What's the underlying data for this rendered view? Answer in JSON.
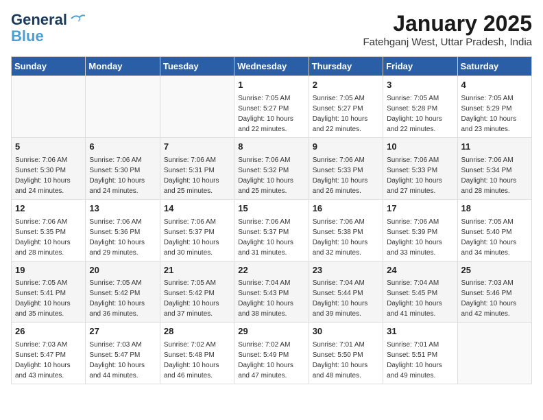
{
  "header": {
    "logo": {
      "line1": "General",
      "line2": "Blue"
    },
    "month": "January 2025",
    "location": "Fatehganj West, Uttar Pradesh, India"
  },
  "weekdays": [
    "Sunday",
    "Monday",
    "Tuesday",
    "Wednesday",
    "Thursday",
    "Friday",
    "Saturday"
  ],
  "weeks": [
    [
      {
        "day": "",
        "sunrise": "",
        "sunset": "",
        "daylight": ""
      },
      {
        "day": "",
        "sunrise": "",
        "sunset": "",
        "daylight": ""
      },
      {
        "day": "",
        "sunrise": "",
        "sunset": "",
        "daylight": ""
      },
      {
        "day": "1",
        "sunrise": "Sunrise: 7:05 AM",
        "sunset": "Sunset: 5:27 PM",
        "daylight": "Daylight: 10 hours and 22 minutes."
      },
      {
        "day": "2",
        "sunrise": "Sunrise: 7:05 AM",
        "sunset": "Sunset: 5:27 PM",
        "daylight": "Daylight: 10 hours and 22 minutes."
      },
      {
        "day": "3",
        "sunrise": "Sunrise: 7:05 AM",
        "sunset": "Sunset: 5:28 PM",
        "daylight": "Daylight: 10 hours and 22 minutes."
      },
      {
        "day": "4",
        "sunrise": "Sunrise: 7:05 AM",
        "sunset": "Sunset: 5:29 PM",
        "daylight": "Daylight: 10 hours and 23 minutes."
      }
    ],
    [
      {
        "day": "5",
        "sunrise": "Sunrise: 7:06 AM",
        "sunset": "Sunset: 5:30 PM",
        "daylight": "Daylight: 10 hours and 24 minutes."
      },
      {
        "day": "6",
        "sunrise": "Sunrise: 7:06 AM",
        "sunset": "Sunset: 5:30 PM",
        "daylight": "Daylight: 10 hours and 24 minutes."
      },
      {
        "day": "7",
        "sunrise": "Sunrise: 7:06 AM",
        "sunset": "Sunset: 5:31 PM",
        "daylight": "Daylight: 10 hours and 25 minutes."
      },
      {
        "day": "8",
        "sunrise": "Sunrise: 7:06 AM",
        "sunset": "Sunset: 5:32 PM",
        "daylight": "Daylight: 10 hours and 25 minutes."
      },
      {
        "day": "9",
        "sunrise": "Sunrise: 7:06 AM",
        "sunset": "Sunset: 5:33 PM",
        "daylight": "Daylight: 10 hours and 26 minutes."
      },
      {
        "day": "10",
        "sunrise": "Sunrise: 7:06 AM",
        "sunset": "Sunset: 5:33 PM",
        "daylight": "Daylight: 10 hours and 27 minutes."
      },
      {
        "day": "11",
        "sunrise": "Sunrise: 7:06 AM",
        "sunset": "Sunset: 5:34 PM",
        "daylight": "Daylight: 10 hours and 28 minutes."
      }
    ],
    [
      {
        "day": "12",
        "sunrise": "Sunrise: 7:06 AM",
        "sunset": "Sunset: 5:35 PM",
        "daylight": "Daylight: 10 hours and 28 minutes."
      },
      {
        "day": "13",
        "sunrise": "Sunrise: 7:06 AM",
        "sunset": "Sunset: 5:36 PM",
        "daylight": "Daylight: 10 hours and 29 minutes."
      },
      {
        "day": "14",
        "sunrise": "Sunrise: 7:06 AM",
        "sunset": "Sunset: 5:37 PM",
        "daylight": "Daylight: 10 hours and 30 minutes."
      },
      {
        "day": "15",
        "sunrise": "Sunrise: 7:06 AM",
        "sunset": "Sunset: 5:37 PM",
        "daylight": "Daylight: 10 hours and 31 minutes."
      },
      {
        "day": "16",
        "sunrise": "Sunrise: 7:06 AM",
        "sunset": "Sunset: 5:38 PM",
        "daylight": "Daylight: 10 hours and 32 minutes."
      },
      {
        "day": "17",
        "sunrise": "Sunrise: 7:06 AM",
        "sunset": "Sunset: 5:39 PM",
        "daylight": "Daylight: 10 hours and 33 minutes."
      },
      {
        "day": "18",
        "sunrise": "Sunrise: 7:05 AM",
        "sunset": "Sunset: 5:40 PM",
        "daylight": "Daylight: 10 hours and 34 minutes."
      }
    ],
    [
      {
        "day": "19",
        "sunrise": "Sunrise: 7:05 AM",
        "sunset": "Sunset: 5:41 PM",
        "daylight": "Daylight: 10 hours and 35 minutes."
      },
      {
        "day": "20",
        "sunrise": "Sunrise: 7:05 AM",
        "sunset": "Sunset: 5:42 PM",
        "daylight": "Daylight: 10 hours and 36 minutes."
      },
      {
        "day": "21",
        "sunrise": "Sunrise: 7:05 AM",
        "sunset": "Sunset: 5:42 PM",
        "daylight": "Daylight: 10 hours and 37 minutes."
      },
      {
        "day": "22",
        "sunrise": "Sunrise: 7:04 AM",
        "sunset": "Sunset: 5:43 PM",
        "daylight": "Daylight: 10 hours and 38 minutes."
      },
      {
        "day": "23",
        "sunrise": "Sunrise: 7:04 AM",
        "sunset": "Sunset: 5:44 PM",
        "daylight": "Daylight: 10 hours and 39 minutes."
      },
      {
        "day": "24",
        "sunrise": "Sunrise: 7:04 AM",
        "sunset": "Sunset: 5:45 PM",
        "daylight": "Daylight: 10 hours and 41 minutes."
      },
      {
        "day": "25",
        "sunrise": "Sunrise: 7:03 AM",
        "sunset": "Sunset: 5:46 PM",
        "daylight": "Daylight: 10 hours and 42 minutes."
      }
    ],
    [
      {
        "day": "26",
        "sunrise": "Sunrise: 7:03 AM",
        "sunset": "Sunset: 5:47 PM",
        "daylight": "Daylight: 10 hours and 43 minutes."
      },
      {
        "day": "27",
        "sunrise": "Sunrise: 7:03 AM",
        "sunset": "Sunset: 5:47 PM",
        "daylight": "Daylight: 10 hours and 44 minutes."
      },
      {
        "day": "28",
        "sunrise": "Sunrise: 7:02 AM",
        "sunset": "Sunset: 5:48 PM",
        "daylight": "Daylight: 10 hours and 46 minutes."
      },
      {
        "day": "29",
        "sunrise": "Sunrise: 7:02 AM",
        "sunset": "Sunset: 5:49 PM",
        "daylight": "Daylight: 10 hours and 47 minutes."
      },
      {
        "day": "30",
        "sunrise": "Sunrise: 7:01 AM",
        "sunset": "Sunset: 5:50 PM",
        "daylight": "Daylight: 10 hours and 48 minutes."
      },
      {
        "day": "31",
        "sunrise": "Sunrise: 7:01 AM",
        "sunset": "Sunset: 5:51 PM",
        "daylight": "Daylight: 10 hours and 49 minutes."
      },
      {
        "day": "",
        "sunrise": "",
        "sunset": "",
        "daylight": ""
      }
    ]
  ]
}
